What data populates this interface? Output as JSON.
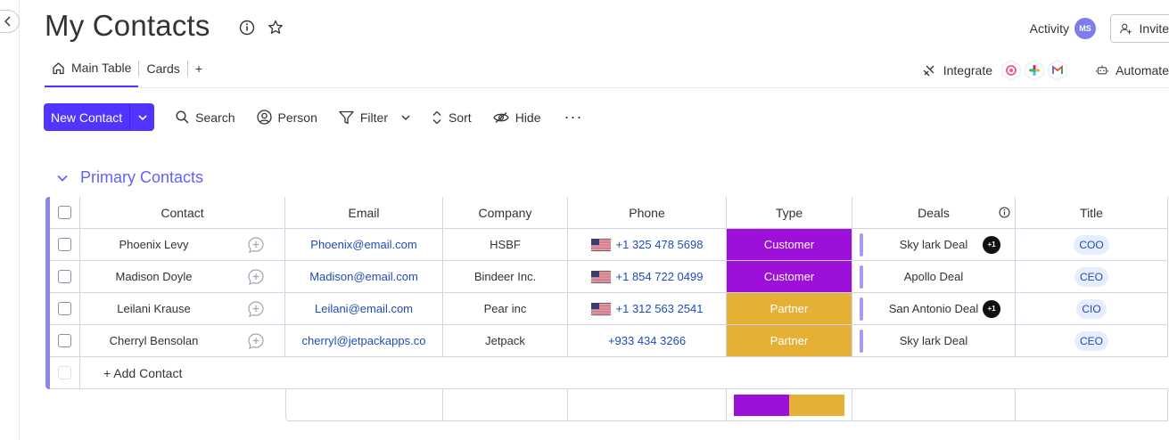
{
  "header": {
    "title": "My Contacts",
    "activity_label": "Activity",
    "avatar_initials": "MS",
    "invite_label": "Invite"
  },
  "tabs": [
    {
      "label": "Main Table"
    },
    {
      "label": "Cards"
    },
    {
      "label": "+"
    }
  ],
  "right_tools": {
    "integrate_label": "Integrate",
    "automate_label": "Automate"
  },
  "toolbar": {
    "new_label": "New Contact",
    "search_label": "Search",
    "person_label": "Person",
    "filter_label": "Filter",
    "sort_label": "Sort",
    "hide_label": "Hide",
    "more_label": "···"
  },
  "group": {
    "title": "Primary Contacts",
    "color": "#6161ff"
  },
  "columns": {
    "contact": "Contact",
    "email": "Email",
    "company": "Company",
    "phone": "Phone",
    "type": "Type",
    "deals": "Deals",
    "title": "Title"
  },
  "rows": [
    {
      "name": "Phoenix Levy",
      "email": "Phoenix@email.com",
      "company": "HSBF",
      "phone": "+1 325 478 5698",
      "flag": true,
      "type": "Customer",
      "deal": "Sky lark Deal",
      "deal_extra": "+1",
      "title": "COO"
    },
    {
      "name": "Madison Doyle",
      "email": "Madison@email.com",
      "company": "Bindeer Inc.",
      "phone": "+1 854 722 0499",
      "flag": true,
      "type": "Customer",
      "deal": "Apollo Deal",
      "deal_extra": "",
      "title": "CEO"
    },
    {
      "name": "Leilani Krause",
      "email": "Leilani@email.com",
      "company": "Pear inc",
      "phone": "+1 312 563 2541",
      "flag": true,
      "type": "Partner",
      "deal": "San Antonio Deal",
      "deal_extra": "+1",
      "title": "CIO"
    },
    {
      "name": "Cherryl Bensolan",
      "email": "cherryl@jetpackapps.co",
      "company": "Jetpack",
      "phone": "+933 434 3266",
      "flag": false,
      "type": "Partner",
      "deal": "Sky lark Deal",
      "deal_extra": "",
      "title": "CEO"
    }
  ],
  "add_row_label": "+ Add Contact",
  "colors": {
    "accent": "#5034ff",
    "customer": "#9d10d9",
    "partner": "#e5b035"
  },
  "type_summary": {
    "customer_fraction": 0.5,
    "partner_fraction": 0.5
  }
}
